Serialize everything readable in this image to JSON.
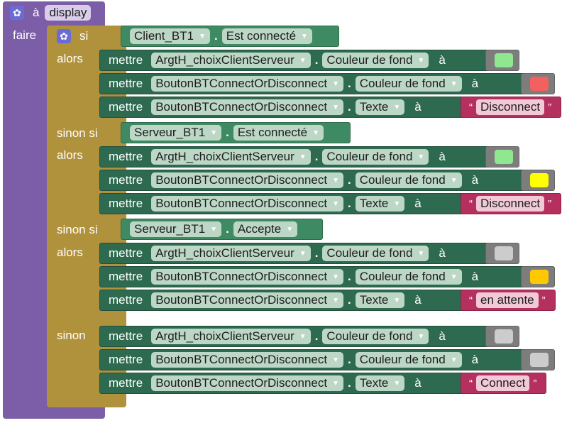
{
  "procedure": {
    "prefix": "à",
    "name": "display",
    "do_label": "faire"
  },
  "if_block": {
    "if_label": "si",
    "then_label": "alors",
    "elseif_label": "sinon si",
    "else_label": "sinon"
  },
  "conditions": [
    {
      "component": "Client_BT1",
      "property": "Est connecté"
    },
    {
      "component": "Serveur_BT1",
      "property": "Est connecté"
    },
    {
      "component": "Serveur_BT1",
      "property": "Accepte"
    }
  ],
  "set_label": "mettre",
  "to_label": "à",
  "branches": [
    [
      {
        "component": "ArgtH_choixClientServeur",
        "property": "Couleur de fond",
        "kind": "color",
        "color": "#8fe88f"
      },
      {
        "component": "BoutonBTConnectOrDisconnect",
        "property": "Couleur de fond",
        "kind": "color",
        "color": "#f26060"
      },
      {
        "component": "BoutonBTConnectOrDisconnect",
        "property": "Texte",
        "kind": "text",
        "text": "Disconnect"
      }
    ],
    [
      {
        "component": "ArgtH_choixClientServeur",
        "property": "Couleur de fond",
        "kind": "color",
        "color": "#8fe88f"
      },
      {
        "component": "BoutonBTConnectOrDisconnect",
        "property": "Couleur de fond",
        "kind": "color",
        "color": "#ffff00"
      },
      {
        "component": "BoutonBTConnectOrDisconnect",
        "property": "Texte",
        "kind": "text",
        "text": "Disconnect"
      }
    ],
    [
      {
        "component": "ArgtH_choixClientServeur",
        "property": "Couleur de fond",
        "kind": "color",
        "color": "#cccccc"
      },
      {
        "component": "BoutonBTConnectOrDisconnect",
        "property": "Couleur de fond",
        "kind": "color",
        "color": "#ffc800"
      },
      {
        "component": "BoutonBTConnectOrDisconnect",
        "property": "Texte",
        "kind": "text",
        "text": "en attente"
      }
    ],
    [
      {
        "component": "ArgtH_choixClientServeur",
        "property": "Couleur de fond",
        "kind": "color",
        "color": "#cccccc"
      },
      {
        "component": "BoutonBTConnectOrDisconnect",
        "property": "Couleur de fond",
        "kind": "color",
        "color": "#cccccc"
      },
      {
        "component": "BoutonBTConnectOrDisconnect",
        "property": "Texte",
        "kind": "text",
        "text": "Connect"
      }
    ]
  ],
  "colors": {
    "procedure": "#7b5ea7",
    "control": "#b0913c",
    "setter": "#2d6a4f",
    "getter": "#3e8a63",
    "text_block": "#b5305f",
    "color_block": "#7d7d7d"
  },
  "icons": {
    "procedure": "gear-icon",
    "if": "gear-icon"
  }
}
